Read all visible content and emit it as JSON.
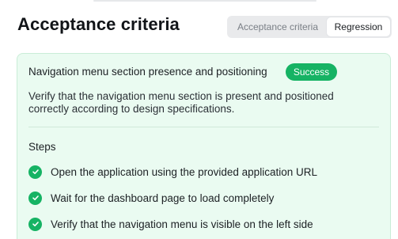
{
  "header": {
    "title": "Acceptance criteria"
  },
  "tabs": [
    {
      "label": "Acceptance criteria",
      "selected": false
    },
    {
      "label": "Regression",
      "selected": true
    }
  ],
  "criterion": {
    "title": "Navigation menu section presence and positioning",
    "status": "Success",
    "status_color": "#16b364",
    "description": "Verify that the navigation menu section is present and positioned correctly according to design specifications.",
    "steps_heading": "Steps",
    "steps": [
      {
        "text": "Open the application using the provided application URL",
        "status_icon": "check-circle-icon"
      },
      {
        "text": "Wait for the dashboard page to load completely",
        "status_icon": "check-circle-icon"
      },
      {
        "text": "Verify that the navigation menu is visible on the left side",
        "status_icon": "check-circle-icon"
      }
    ]
  },
  "colors": {
    "card_background": "#eafbf1",
    "card_border": "#c9edd7",
    "success": "#16b364"
  }
}
